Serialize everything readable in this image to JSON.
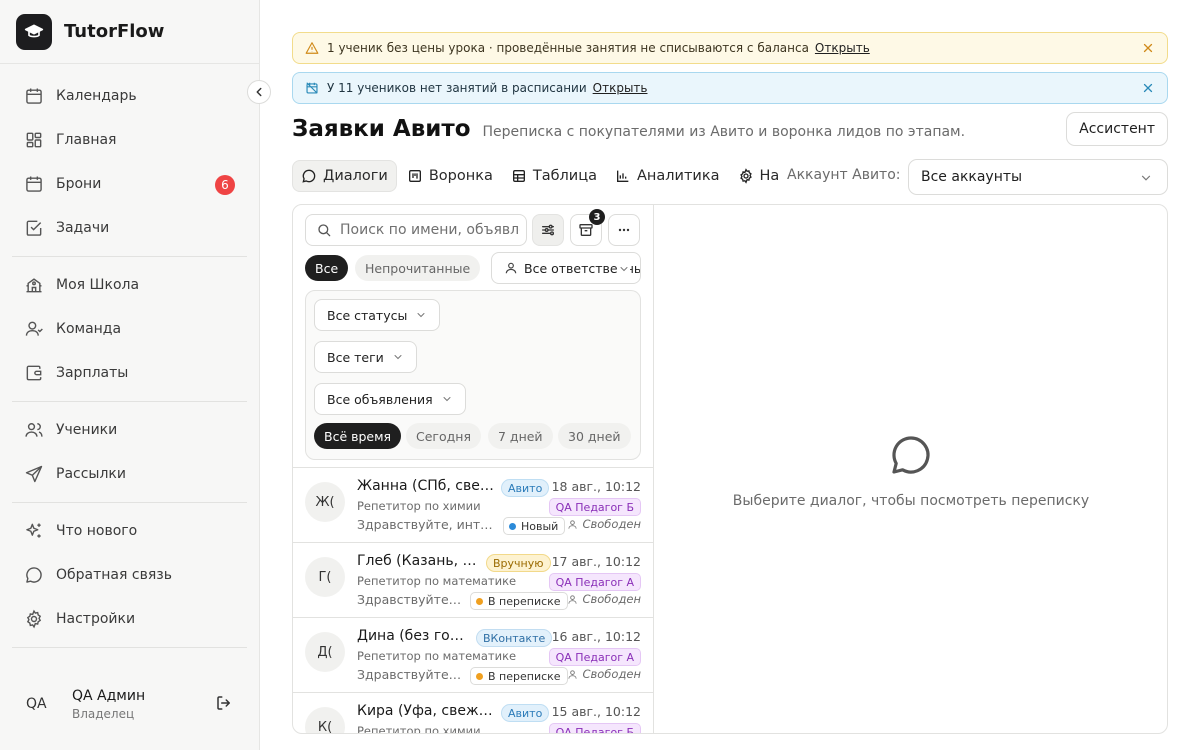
{
  "app": {
    "name": "TutorFlow"
  },
  "sidebar": {
    "items": [
      {
        "label": "Календарь",
        "icon": "calendar-icon"
      },
      {
        "label": "Главная",
        "icon": "dashboard-icon"
      },
      {
        "label": "Брони",
        "icon": "calendar-icon",
        "badge": "6"
      },
      {
        "label": "Задачи",
        "icon": "check-square-icon"
      },
      {
        "label": "Моя Школа",
        "icon": "school-icon"
      },
      {
        "label": "Команда",
        "icon": "user-icon"
      },
      {
        "label": "Зарплаты",
        "icon": "wallet-icon"
      },
      {
        "label": "Ученики",
        "icon": "users-icon"
      },
      {
        "label": "Рассылки",
        "icon": "send-icon"
      },
      {
        "label": "Что нового",
        "icon": "sparkles-icon"
      },
      {
        "label": "Обратная связь",
        "icon": "message-icon"
      },
      {
        "label": "Настройки",
        "icon": "gear-icon"
      }
    ],
    "user": {
      "initials": "QA",
      "name": "QA Админ",
      "role": "Владелец"
    }
  },
  "banners": {
    "warning": {
      "text": "1 ученик без цены урока · проведённые занятия не списываются с баланса",
      "link": "Открыть"
    },
    "info": {
      "text": "У 11 учеников нет занятий в расписании",
      "link": "Открыть"
    }
  },
  "page": {
    "title": "Заявки Авито",
    "subtitle": "Переписка с покупателями из Авито и воронка лидов по этапам.",
    "assistant_button": "Ассистент"
  },
  "tabs": [
    {
      "label": "Диалоги",
      "icon": "chat-icon",
      "active": true
    },
    {
      "label": "Воронка",
      "icon": "kanban-icon"
    },
    {
      "label": "Таблица",
      "icon": "table-icon"
    },
    {
      "label": "Аналитика",
      "icon": "bar-chart-icon"
    },
    {
      "label": "Настройки",
      "icon": "gear-icon"
    }
  ],
  "account": {
    "label": "Аккаунт Авито:",
    "value": "Все аккаунты"
  },
  "list": {
    "search_placeholder": "Поиск по имени, объявлению",
    "archive_count": "3",
    "chips": {
      "all": "Все",
      "unread": "Непрочитанные"
    },
    "responsible": "Все ответственные",
    "filters": {
      "statuses": "Все статусы",
      "tags": "Все теги",
      "ads": "Все объявления"
    },
    "periods": [
      "Всё время",
      "Сегодня",
      "7 дней",
      "30 дней"
    ],
    "conversations": [
      {
        "initials": "Ж(",
        "name": "Жанна (СПб, свежий)",
        "source": "Авито",
        "source_type": "avito",
        "date": "18 авг., 10:12",
        "subject": "Репетитор по химии",
        "teacher": "QA Педагог Б",
        "preview": "Здравствуйте, интересует",
        "status": "Новый",
        "status_color": "#2b8ad8",
        "assignee": "Свободен"
      },
      {
        "initials": "Г(",
        "name": "Глеб (Казань, повтор)",
        "source": "Вручную",
        "source_type": "manual",
        "date": "17 авг., 10:12",
        "subject": "Репетитор по математике",
        "teacher": "QA Педагог А",
        "preview": "Здравствуйте, хочу",
        "status": "В переписке",
        "status_color": "#f0a020",
        "assignee": "Свободен"
      },
      {
        "initials": "Д(",
        "name": "Дина (без города)",
        "source": "ВКонтакте",
        "source_type": "vk",
        "date": "16 авг., 10:12",
        "subject": "Репетитор по математике",
        "teacher": "QA Педагог А",
        "preview": "Здравствуйте, хочу",
        "status": "В переписке",
        "status_color": "#f0a020",
        "assignee": "Свободен"
      },
      {
        "initials": "К(",
        "name": "Кира (Уфа, свежий)",
        "source": "Авито",
        "source_type": "avito",
        "date": "15 авг., 10:12",
        "subject": "Репетитор по химии",
        "teacher": "QA Педагог Б",
        "preview": "",
        "status": "",
        "status_color": "#2b8ad8",
        "assignee": ""
      }
    ]
  },
  "empty": {
    "text": "Выберите диалог, чтобы посмотреть переписку"
  }
}
